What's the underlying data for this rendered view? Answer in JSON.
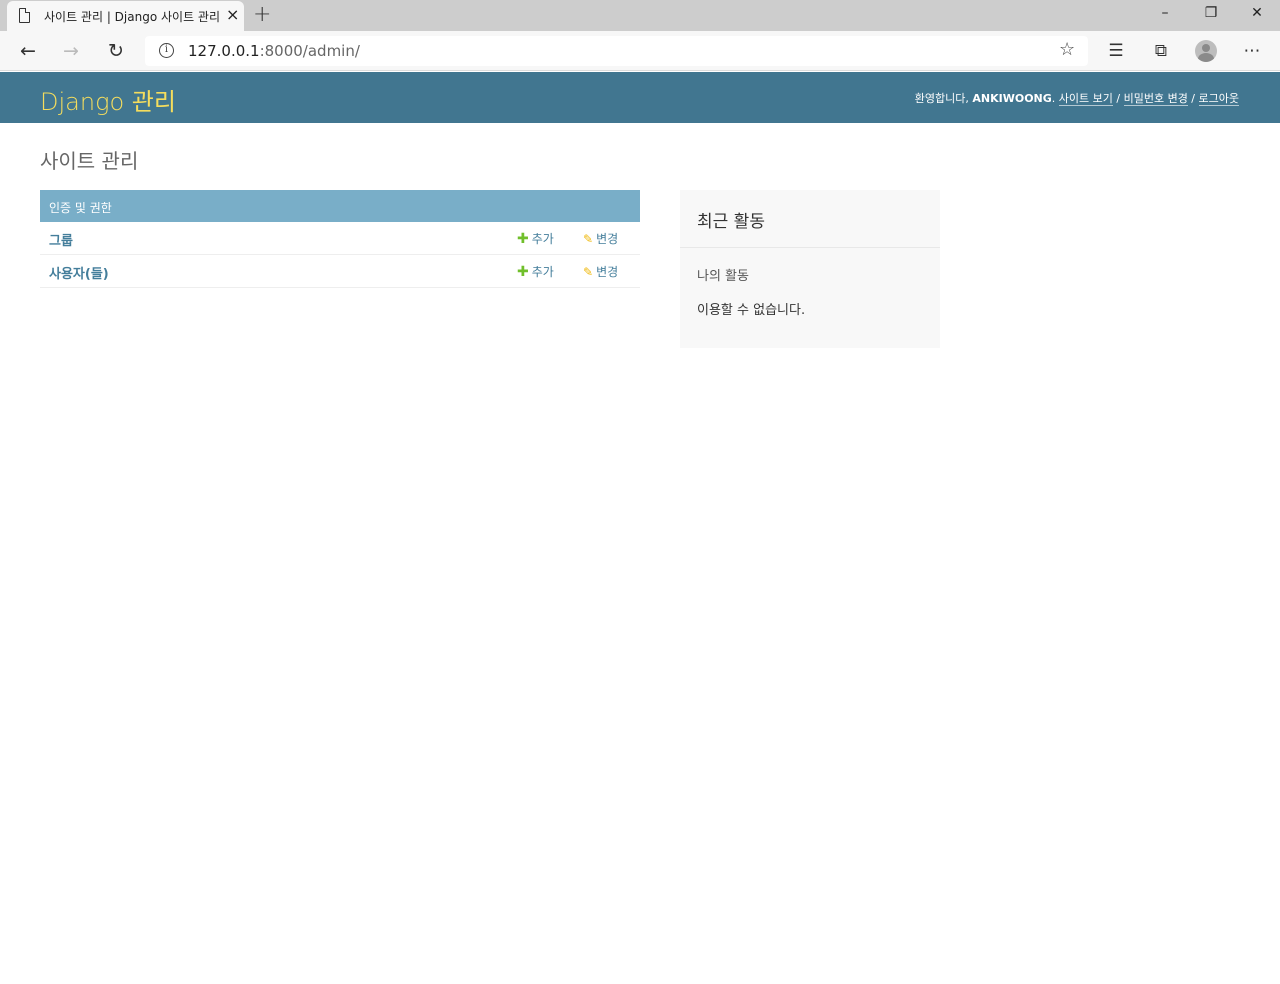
{
  "browser": {
    "tab_title": "사이트 관리 | Django 사이트 관리",
    "tab_close": "×",
    "new_tab": "+",
    "url_host": "127.0.0.1",
    "url_rest": ":8000/admin/",
    "win_min": "–",
    "win_restore": "❐",
    "win_close": "✕"
  },
  "header": {
    "branding": "Django 관리",
    "welcome": "환영합니다, ",
    "username": "ANKIWOONG",
    "sep1": ". ",
    "view_site": "사이트 보기",
    "slash1": " / ",
    "change_password": "비밀번호 변경",
    "slash2": " / ",
    "logout": "로그아웃"
  },
  "content": {
    "title": "사이트 관리",
    "app_module": {
      "caption": "인증 및 권한",
      "models": [
        {
          "name": "그룹",
          "add": "추가",
          "change": "변경"
        },
        {
          "name": "사용자(들)",
          "add": "추가",
          "change": "변경"
        }
      ]
    },
    "recent_actions": {
      "title": "최근 활동",
      "subtitle": "나의 활동",
      "empty": "이용할 수 없습니다."
    }
  },
  "icons": {
    "plus": "✚",
    "pencil": "✎"
  },
  "colors": {
    "header_bg": "#417690",
    "branding": "#f5dd5d",
    "caption_bg": "#79aec8",
    "link": "#447e9b"
  }
}
